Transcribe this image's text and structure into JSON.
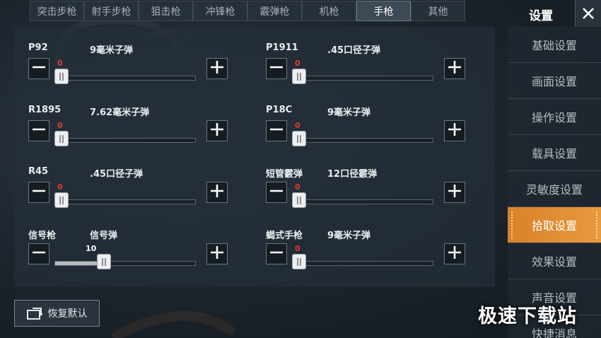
{
  "tabs": [
    "突击步枪",
    "射手步枪",
    "狙击枪",
    "冲锋枪",
    "霰弹枪",
    "机枪",
    "手枪",
    "其他"
  ],
  "active_tab": 6,
  "weapons": [
    {
      "name": "P92",
      "ammo": "9毫米子弹",
      "value": "0",
      "level": 0
    },
    {
      "name": "P1911",
      "ammo": ".45口径子弹",
      "value": "0",
      "level": 0
    },
    {
      "name": "R1895",
      "ammo": "7.62毫米子弹",
      "value": "0",
      "level": 0
    },
    {
      "name": "P18C",
      "ammo": "9毫米子弹",
      "value": "0",
      "level": 0
    },
    {
      "name": "R45",
      "ammo": ".45口径子弹",
      "value": "0",
      "level": 0
    },
    {
      "name": "短管霰弹",
      "ammo": "12口径霰弹",
      "value": "0",
      "level": 0
    },
    {
      "name": "信号枪",
      "ammo": "信号弹",
      "value": "10",
      "level": 1.0
    },
    {
      "name": "蝎式手枪",
      "ammo": "9毫米子弹",
      "value": "0",
      "level": 0
    }
  ],
  "reset_label": "恢复默认",
  "settings": {
    "title": "设置",
    "items": [
      "基础设置",
      "画面设置",
      "操作设置",
      "载具设置",
      "灵敏度设置",
      "拾取设置",
      "效果设置",
      "声音设置",
      "快捷消息"
    ],
    "active_index": 5
  },
  "watermark": "极速下载站",
  "colors": {
    "accent": "#e08c30",
    "value_zero": "#e23a2a",
    "value_set": "#ffffff"
  }
}
